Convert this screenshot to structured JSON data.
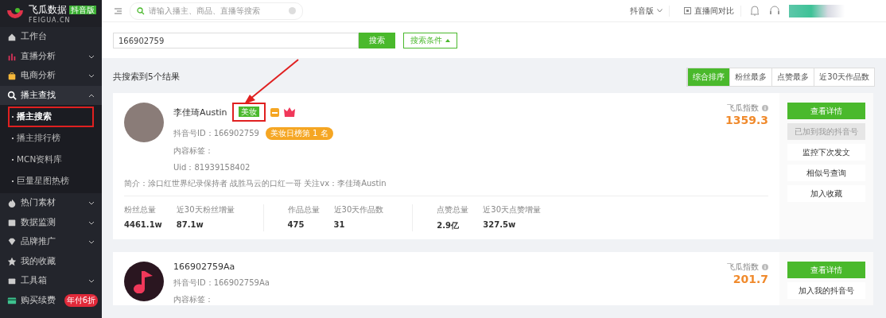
{
  "brand": {
    "name": "飞瓜数据",
    "edition": "抖音版",
    "domain": "FEIGUA.CN"
  },
  "sidebar": {
    "items": [
      {
        "label": "工作台",
        "expanded": false,
        "has_children": false
      },
      {
        "label": "直播分析",
        "expanded": false,
        "has_children": true
      },
      {
        "label": "电商分析",
        "expanded": false,
        "has_children": true
      },
      {
        "label": "播主查找",
        "expanded": true,
        "has_children": true,
        "children": [
          {
            "label": "播主搜索",
            "selected": true,
            "annotated": true
          },
          {
            "label": "播主排行榜",
            "selected": false,
            "annotated": false
          },
          {
            "label": "MCN资料库",
            "selected": false,
            "annotated": false
          },
          {
            "label": "巨量星图热榜",
            "selected": false,
            "annotated": false
          }
        ]
      },
      {
        "label": "热门素材",
        "expanded": false,
        "has_children": true
      },
      {
        "label": "数据监测",
        "expanded": false,
        "has_children": true
      },
      {
        "label": "品牌推广",
        "expanded": false,
        "has_children": true
      },
      {
        "label": "我的收藏",
        "expanded": false,
        "has_children": false
      },
      {
        "label": "工具箱",
        "expanded": false,
        "has_children": true
      },
      {
        "label": "购买续费",
        "expanded": false,
        "has_children": false,
        "badge": "年付6折"
      }
    ]
  },
  "topbar": {
    "search_placeholder": "请输入播主、商品、直播等搜索",
    "version": "抖音版",
    "compare": "直播间对比"
  },
  "search": {
    "value": "166902759",
    "button": "搜索",
    "conditions": "搜索条件"
  },
  "results": {
    "summary": "共搜索到5个结果",
    "sorts": [
      {
        "label": "综合排序",
        "selected": true
      },
      {
        "label": "粉丝最多",
        "selected": false
      },
      {
        "label": "点赞最多",
        "selected": false
      },
      {
        "label": "近30天作品数",
        "selected": false
      }
    ]
  },
  "cards": [
    {
      "name": "李佳琦Austin",
      "tag": "美妆",
      "tag_annotated": true,
      "badges": true,
      "id": "抖音号ID：166902759",
      "rank": "美妆日榜第 1 名",
      "content_tags": "内容标签：",
      "uid": "Uid：81939158402",
      "intro": "简介：涂口红世界纪录保持者 战胜马云的口红一哥 关注vx：李佳琦Austin",
      "stats": [
        [
          {
            "label": "粉丝总量",
            "value": "4461.1w"
          },
          {
            "label": "近30天粉丝增量",
            "value": "87.1w"
          }
        ],
        [
          {
            "label": "作品总量",
            "value": "475"
          },
          {
            "label": "近30天作品数",
            "value": "31"
          }
        ],
        [
          {
            "label": "点赞总量",
            "value": "2.9亿"
          },
          {
            "label": "近30天点赞增量",
            "value": "327.5w"
          }
        ]
      ],
      "index_label": "飞瓜指数",
      "index": "1359.3",
      "actions": [
        {
          "label": "查看详情",
          "kind": "primary"
        },
        {
          "label": "已加到我的抖音号",
          "kind": "disabled"
        },
        {
          "label": "监控下次发文",
          "kind": "plain"
        },
        {
          "label": "相似号查询",
          "kind": "plain"
        },
        {
          "label": "加入收藏",
          "kind": "plain"
        }
      ]
    },
    {
      "name": "166902759Aa",
      "badges": false,
      "id": "抖音号ID：166902759Aa",
      "content_tags": "内容标签：",
      "index_label": "飞瓜指数",
      "index": "201.7",
      "actions": [
        {
          "label": "查看详情",
          "kind": "primary"
        },
        {
          "label": "加入我的抖音号",
          "kind": "plain"
        }
      ]
    }
  ]
}
